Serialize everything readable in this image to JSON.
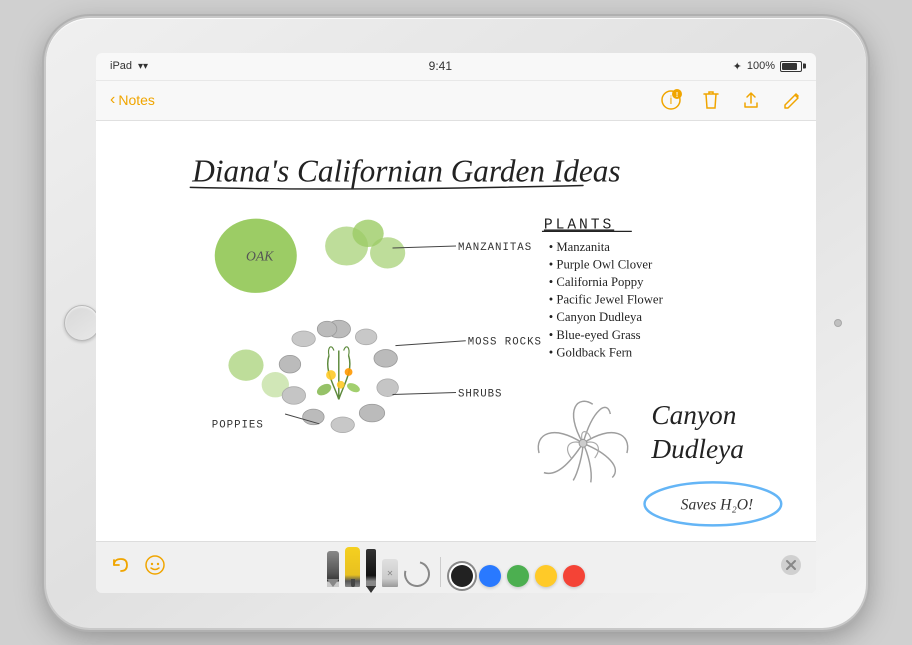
{
  "device": {
    "status_bar": {
      "left": "iPad",
      "wifi": "wifi",
      "time": "9:41",
      "bluetooth": "bluetooth",
      "battery_pct": "100%"
    },
    "nav_bar": {
      "back_label": "Notes",
      "icons": [
        "share-with-badge",
        "trash",
        "upload",
        "compose"
      ]
    }
  },
  "note": {
    "title": "Diana's Californian Garden Ideas",
    "plants_heading": "PLANTS",
    "labels": {
      "oak": "OAK",
      "manzanitas": "MANZANITAS",
      "moss_rocks": "MOSS ROCKS",
      "shrubs": "SHRUBS",
      "poppies": "POPPIES"
    },
    "plants_list": [
      "Manzanita",
      "Purple Owl Clover",
      "California Poppy",
      "Pacific Jewel Flower",
      "Canyon Dudleya",
      "Blue-eyed Grass",
      "Goldback Fern"
    ],
    "featured_plant": "Canyon\nDudleya",
    "callout": "Saves H₂O!"
  },
  "toolbar": {
    "undo_label": "undo",
    "emoji_label": "emoji",
    "colors": [
      "#222222",
      "#2979ff",
      "#4caf50",
      "#ffca28",
      "#f44336"
    ]
  }
}
